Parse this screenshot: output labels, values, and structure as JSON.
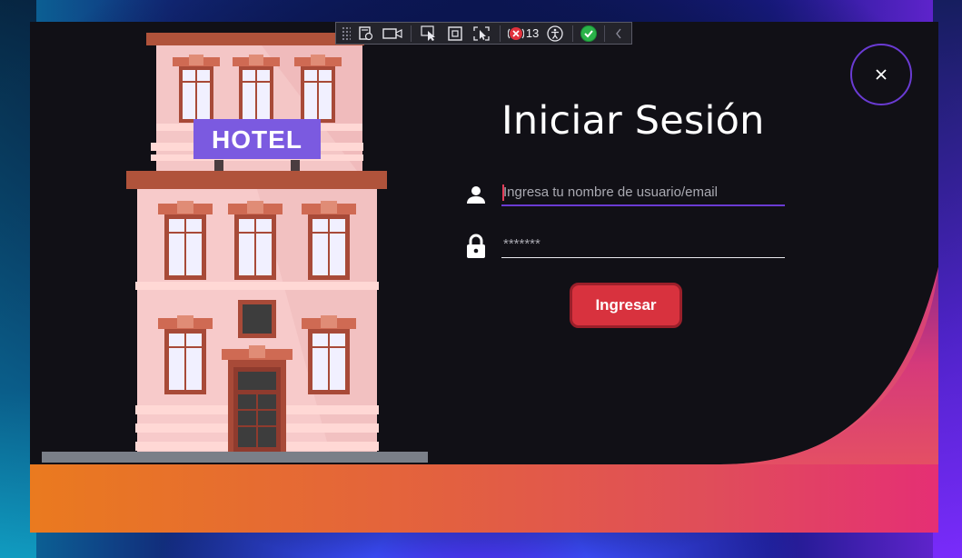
{
  "login": {
    "title": "Iniciar Sesión",
    "username_placeholder": "Ingresa tu nombre de usuario/email",
    "password_placeholder": "*******",
    "button_label": "Ingresar"
  },
  "hotel": {
    "sign_text": "HOTEL"
  },
  "toolbar": {
    "error_count": "13",
    "icons": [
      "grip-icon",
      "select-element-icon",
      "video-icon",
      "pointer-select-icon",
      "layout-adorner-icon",
      "track-focused-icon",
      "binding-errors-icon",
      "accessibility-icon",
      "check-icon",
      "collapse-chevron-icon"
    ]
  },
  "colors": {
    "window_bg": "#111016",
    "accent_purple": "#6a3bd3",
    "button_red": "#d8323e",
    "band_orange": "#ea7a1f",
    "band_pink": "#e52f74",
    "text_white": "#ffffff"
  },
  "icons": {
    "username": "person-icon",
    "password": "lock-icon",
    "close": "close-icon"
  }
}
